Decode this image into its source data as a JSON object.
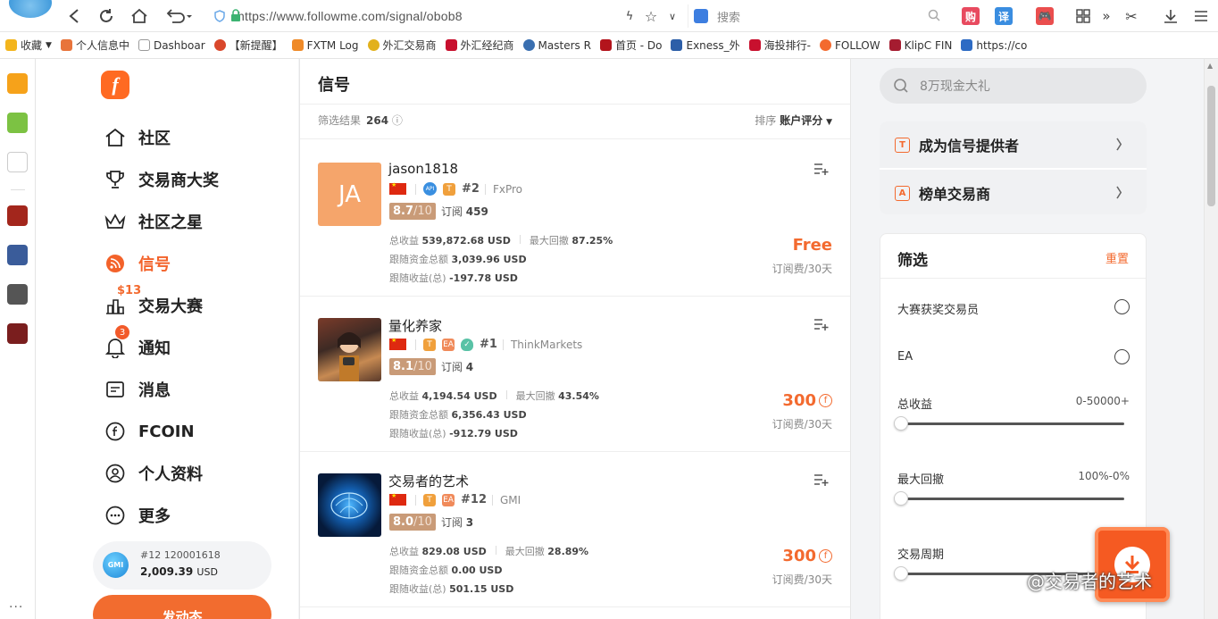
{
  "browser": {
    "url": "https://www.followme.com/signal/obob8",
    "search_placeholder": "搜索",
    "ext_labels": [
      "购",
      "译"
    ],
    "bookmarks": [
      "收藏",
      "个人信息中",
      "Dashboar",
      "【新提醒】",
      "FXTM Log",
      "外汇交易商",
      "外汇经纪商",
      "Masters R",
      "首页 - Do",
      "Exness_外",
      "海投排行-",
      "FOLLOW",
      "KlipC FIN",
      "https://co"
    ],
    "more_dots": "..."
  },
  "sitenav": {
    "logo": "f",
    "items": [
      {
        "label": "社区",
        "icon": "home-icon"
      },
      {
        "label": "交易商大奖",
        "icon": "trophy-icon"
      },
      {
        "label": "社区之星",
        "icon": "crown-icon"
      },
      {
        "label": "信号",
        "icon": "rss-icon"
      },
      {
        "label": "交易大赛",
        "icon": "chart-bars-icon"
      },
      {
        "label": "通知",
        "icon": "bell-icon"
      },
      {
        "label": "消息",
        "icon": "message-icon"
      },
      {
        "label": "FCOIN",
        "icon": "fcoin-icon"
      },
      {
        "label": "个人资料",
        "icon": "user-icon"
      },
      {
        "label": "更多",
        "icon": "more-icon"
      }
    ],
    "competition_badge": "$13",
    "notify_count": "3",
    "account": {
      "broker_logo": "GMI",
      "line": "#12   120001618",
      "balance": "2,009.39",
      "currency": "USD"
    },
    "publish": "发动态"
  },
  "main": {
    "title": "信号",
    "filter_result_label": "筛选结果",
    "filter_result_count": "264",
    "sort_label": "排序",
    "sort_value": "账户评分",
    "signals": [
      {
        "name": "jason1818",
        "avatar_text": "JA",
        "tags": [
          "API",
          "T"
        ],
        "rank": "#2",
        "broker": "FxPro",
        "score": "8.7",
        "score_max": "/10",
        "subs_label": "订阅",
        "subs": "459",
        "total_label": "总收益",
        "total": "539,872.68 USD",
        "dd_label": "最大回撤",
        "dd": "87.25%",
        "follow_funds_label": "跟随资金总额",
        "follow_funds": "3,039.96 USD",
        "follow_profit_label": "跟随收益(总)",
        "follow_profit": "-197.78 USD",
        "price": "Free",
        "period": "订阅费/30天"
      },
      {
        "name": "量化养家",
        "avatar_text": "",
        "tags": [
          "T",
          "EA",
          "✓"
        ],
        "rank": "#1",
        "broker": "ThinkMarkets",
        "score": "8.1",
        "score_max": "/10",
        "subs_label": "订阅",
        "subs": "4",
        "total_label": "总收益",
        "total": "4,194.54 USD",
        "dd_label": "最大回撤",
        "dd": "43.54%",
        "follow_funds_label": "跟随资金总额",
        "follow_funds": "6,356.43 USD",
        "follow_profit_label": "跟随收益(总)",
        "follow_profit": "-912.79 USD",
        "price": "300",
        "period": "订阅费/30天"
      },
      {
        "name": "交易者的艺术",
        "avatar_text": "",
        "tags": [
          "T",
          "EA"
        ],
        "rank": "#12",
        "broker": "GMI",
        "score": "8.0",
        "score_max": "/10",
        "subs_label": "订阅",
        "subs": "3",
        "total_label": "总收益",
        "total": "829.08 USD",
        "dd_label": "最大回撤",
        "dd": "28.89%",
        "follow_funds_label": "跟随资金总额",
        "follow_funds": "0.00 USD",
        "follow_profit_label": "跟随收益(总)",
        "follow_profit": "501.15 USD",
        "price": "300",
        "period": "订阅费/30天"
      }
    ]
  },
  "right": {
    "search_placeholder": "8万现金大礼",
    "links": [
      {
        "icon_letter": "T",
        "label": "成为信号提供者"
      },
      {
        "icon_letter": "A",
        "label": "榜单交易商"
      }
    ],
    "filter": {
      "title": "筛选",
      "reset": "重置",
      "options": [
        "大赛获奖交易员",
        "EA"
      ],
      "ranges": [
        {
          "label": "总收益",
          "value": "0-50000+",
          "knob": 0
        },
        {
          "label": "最大回撤",
          "value": "100%-0%",
          "knob": 0
        },
        {
          "label": "交易周期",
          "value": "",
          "knob": 0
        }
      ]
    }
  },
  "watermark": "@交易者的艺术",
  "colors": {
    "accent": "#f36a2f",
    "score_bg": "#c99b78",
    "avatar_ja": "#f5a56b"
  }
}
